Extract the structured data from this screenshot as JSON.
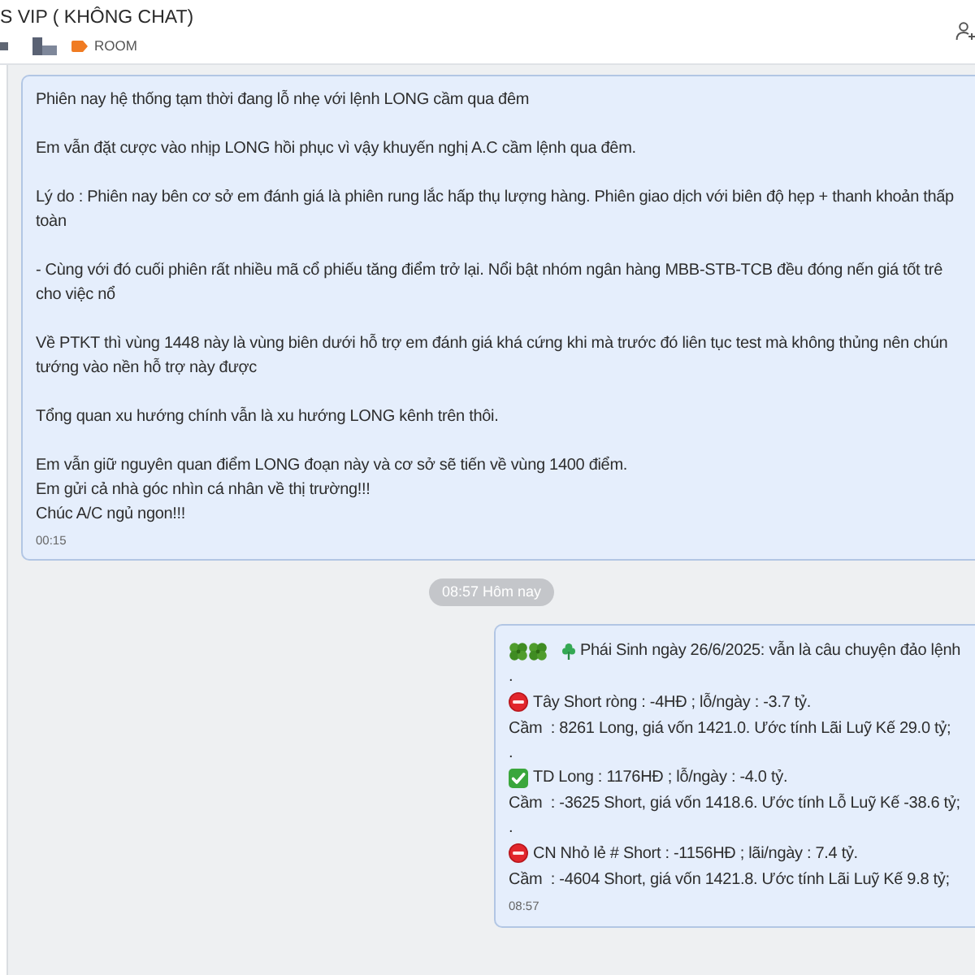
{
  "header": {
    "title": "S VIP ( KHÔNG CHAT)",
    "room_label": "ROOM"
  },
  "chat": [
    {
      "kind": "note",
      "paragraphs": [
        [
          "Phiên nay hệ thống tạm thời đang lỗ nhẹ với lệnh LONG cầm qua đêm"
        ],
        [
          "Em vẫn đặt cược vào nhịp LONG hồi phục vì vậy khuyến nghị A.C cầm lệnh qua đêm."
        ],
        [
          "Lý do : Phiên nay bên cơ sở em đánh giá là phiên rung lắc hấp thụ lượng hàng. Phiên giao dịch với biên độ hẹp + thanh khoản thấp",
          "toàn"
        ],
        [
          "- Cùng với đó cuối phiên rất nhiều mã cổ phiếu tăng điểm trở lại. Nổi bật nhóm ngân hàng MBB-STB-TCB đều đóng nến giá tốt trê",
          "cho việc nổ"
        ],
        [
          "Về PTKT thì vùng 1448 này là vùng biên dưới hỗ trợ em đánh giá khá cứng khi mà trước đó liên tục test mà không thủng nên chún",
          "tướng vào nền hỗ trợ này được"
        ],
        [
          "Tổng quan xu hướng chính vẫn là xu hướng LONG kênh trên thôi."
        ],
        [
          "Em vẫn giữ nguyên quan điểm LONG đoạn này và cơ sở sẽ tiến về vùng 1400 điểm.",
          "Em gửi cả nhà góc nhìn cá nhân về thị trường!!!",
          "Chúc A/C ngủ ngon!!!"
        ]
      ],
      "time": "00:15"
    },
    {
      "kind": "date",
      "label": "08:57 Hôm nay"
    },
    {
      "kind": "report",
      "lines": [
        {
          "kind": "headline",
          "text": "Phái Sinh ngày 26/6/2025: vẫn là câu chuyện đảo lệnh"
        },
        {
          "kind": "plain",
          "text": "."
        },
        {
          "kind": "stop",
          "text": "Tây Short ròng : -4HĐ ; lỗ/ngày : -3.7 tỷ."
        },
        {
          "kind": "plain",
          "text": "Cầm  : 8261 Long, giá vốn 1421.0. Ước tính Lãi Luỹ Kế 29.0 tỷ;"
        },
        {
          "kind": "plain",
          "text": "."
        },
        {
          "kind": "check",
          "text": "TD Long : 1176HĐ ; lỗ/ngày : -4.0 tỷ."
        },
        {
          "kind": "plain",
          "text": "Cầm  : -3625 Short, giá vốn 1418.6. Ước tính Lỗ Luỹ Kế -38.6 tỷ;"
        },
        {
          "kind": "plain",
          "text": "."
        },
        {
          "kind": "stop",
          "text": "CN Nhỏ lẻ # Short : -1156HĐ ; lãi/ngày : 7.4 tỷ."
        },
        {
          "kind": "plain",
          "text": "Cầm  : -4604 Short, giá vốn 1421.8. Ước tính Lãi Luỹ Kế 9.8 tỷ;"
        }
      ],
      "time": "08:57"
    }
  ]
}
